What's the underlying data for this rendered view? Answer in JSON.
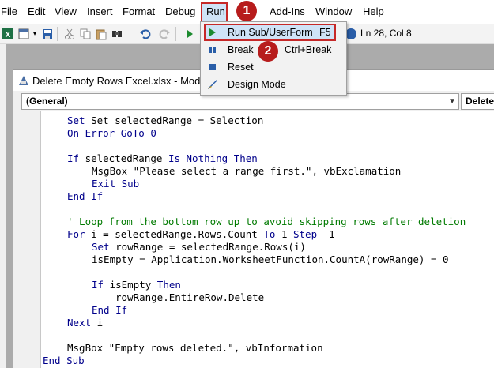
{
  "menubar": {
    "items": [
      {
        "label": "File"
      },
      {
        "label": "Edit"
      },
      {
        "label": "View"
      },
      {
        "label": "Insert"
      },
      {
        "label": "Format"
      },
      {
        "label": "Debug"
      },
      {
        "label": "Run"
      },
      {
        "label": "Add-Ins"
      },
      {
        "label": "Window"
      },
      {
        "label": "Help"
      }
    ]
  },
  "toolbar": {
    "cursor_position": "Ln 28, Col 8"
  },
  "run_menu": {
    "items": [
      {
        "label": "Run Sub/UserForm",
        "shortcut": "F5"
      },
      {
        "label": "Break",
        "shortcut": "Ctrl+Break"
      },
      {
        "label": "Reset",
        "shortcut": ""
      },
      {
        "label": "Design Mode",
        "shortcut": ""
      }
    ]
  },
  "badges": {
    "step1": "1",
    "step2": "2"
  },
  "module_window": {
    "title": "Delete Emoty Rows Excel.xlsx - Module1",
    "object_combo": "(General)",
    "proc_combo": "Delete"
  },
  "code": {
    "l1_a": "Set selectedRange = Selection",
    "l2_kw": "On Error GoTo 0",
    "l3_kw1": "If ",
    "l3_tx": "selectedRange ",
    "l3_kw2": "Is Nothing Then",
    "l4": "MsgBox \"Please select a range first.\", vbExclamation",
    "l5": "Exit Sub",
    "l6": "End If",
    "l7": "' Loop from the bottom row up to avoid skipping rows after deletion",
    "l8_kw1": "For ",
    "l8_tx1": "i = selectedRange.Rows.Count ",
    "l8_kw2": "To ",
    "l8_tx2": "1 ",
    "l8_kw3": "Step ",
    "l8_tx3": "-1",
    "l9_kw": "Set ",
    "l9_tx": "rowRange = selectedRange.Rows(i)",
    "l10": "isEmpty = Application.WorksheetFunction.CountA(rowRange) = 0",
    "l11_kw1": "If ",
    "l11_tx": "isEmpty ",
    "l11_kw2": "Then",
    "l12": "rowRange.EntireRow.Delete",
    "l13": "End If",
    "l14_kw": "Next ",
    "l14_tx": "i",
    "l15": "MsgBox \"Empty rows deleted.\", vbInformation",
    "l16": "End Sub"
  },
  "colors": {
    "keyword": "#00008b",
    "comment": "#007a00",
    "highlight_border": "#c62828",
    "badge": "#b71c1c"
  }
}
